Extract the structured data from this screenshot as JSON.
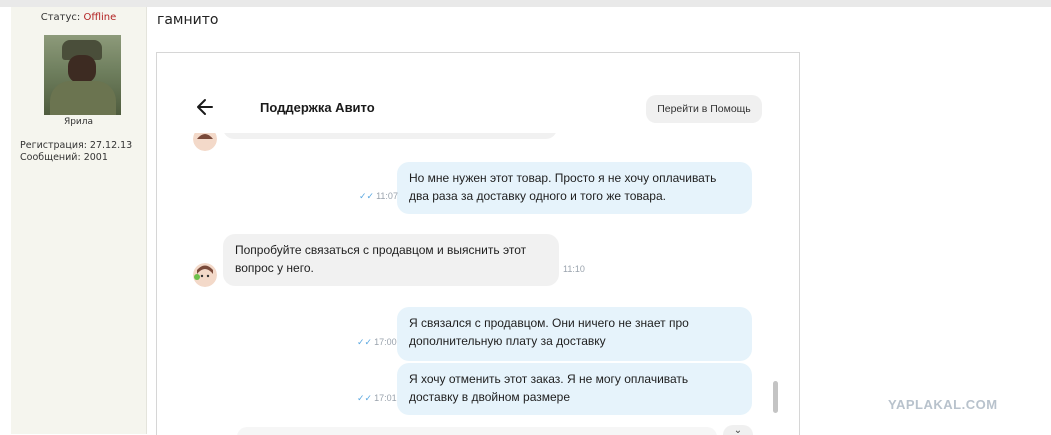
{
  "forum": {
    "status_label": "Статус:",
    "status_value": "Offline",
    "username": "Ярила",
    "registration": "Регистрация: 27.12.13",
    "messages": "Сообщений: 2001",
    "post_text": "гамнито"
  },
  "chat": {
    "title": "Поддержка Авито",
    "help_button": "Перейти в Помощь",
    "messages": [
      {
        "side": "out",
        "line1": "Но мне нужен этот товар. Просто я не хочу оплачивать",
        "line2": "два раза за доставку одного и того же товара.",
        "time": "11:07"
      },
      {
        "side": "in",
        "line1": "Попробуйте связаться с продавцом и выяснить этот",
        "line2": "вопрос у него.",
        "time": "11:10"
      },
      {
        "side": "out",
        "line1": "Я связался с продавцом. Они ничего не знает про",
        "line2": "дополнительную плату за доставку",
        "time": "17:00"
      },
      {
        "side": "out",
        "line1": "Я хочу отменить этот заказ. Я не могу оплачивать",
        "line2": "доставку в двойном размере",
        "time": "17:01"
      }
    ]
  },
  "watermark": "YAPLAKAL.COM",
  "colors": {
    "offline": "#b22222",
    "outgoing_bubble": "#e6f3fb",
    "incoming_bubble": "#f1f1f1",
    "read_ticks": "#5aa7e0"
  }
}
